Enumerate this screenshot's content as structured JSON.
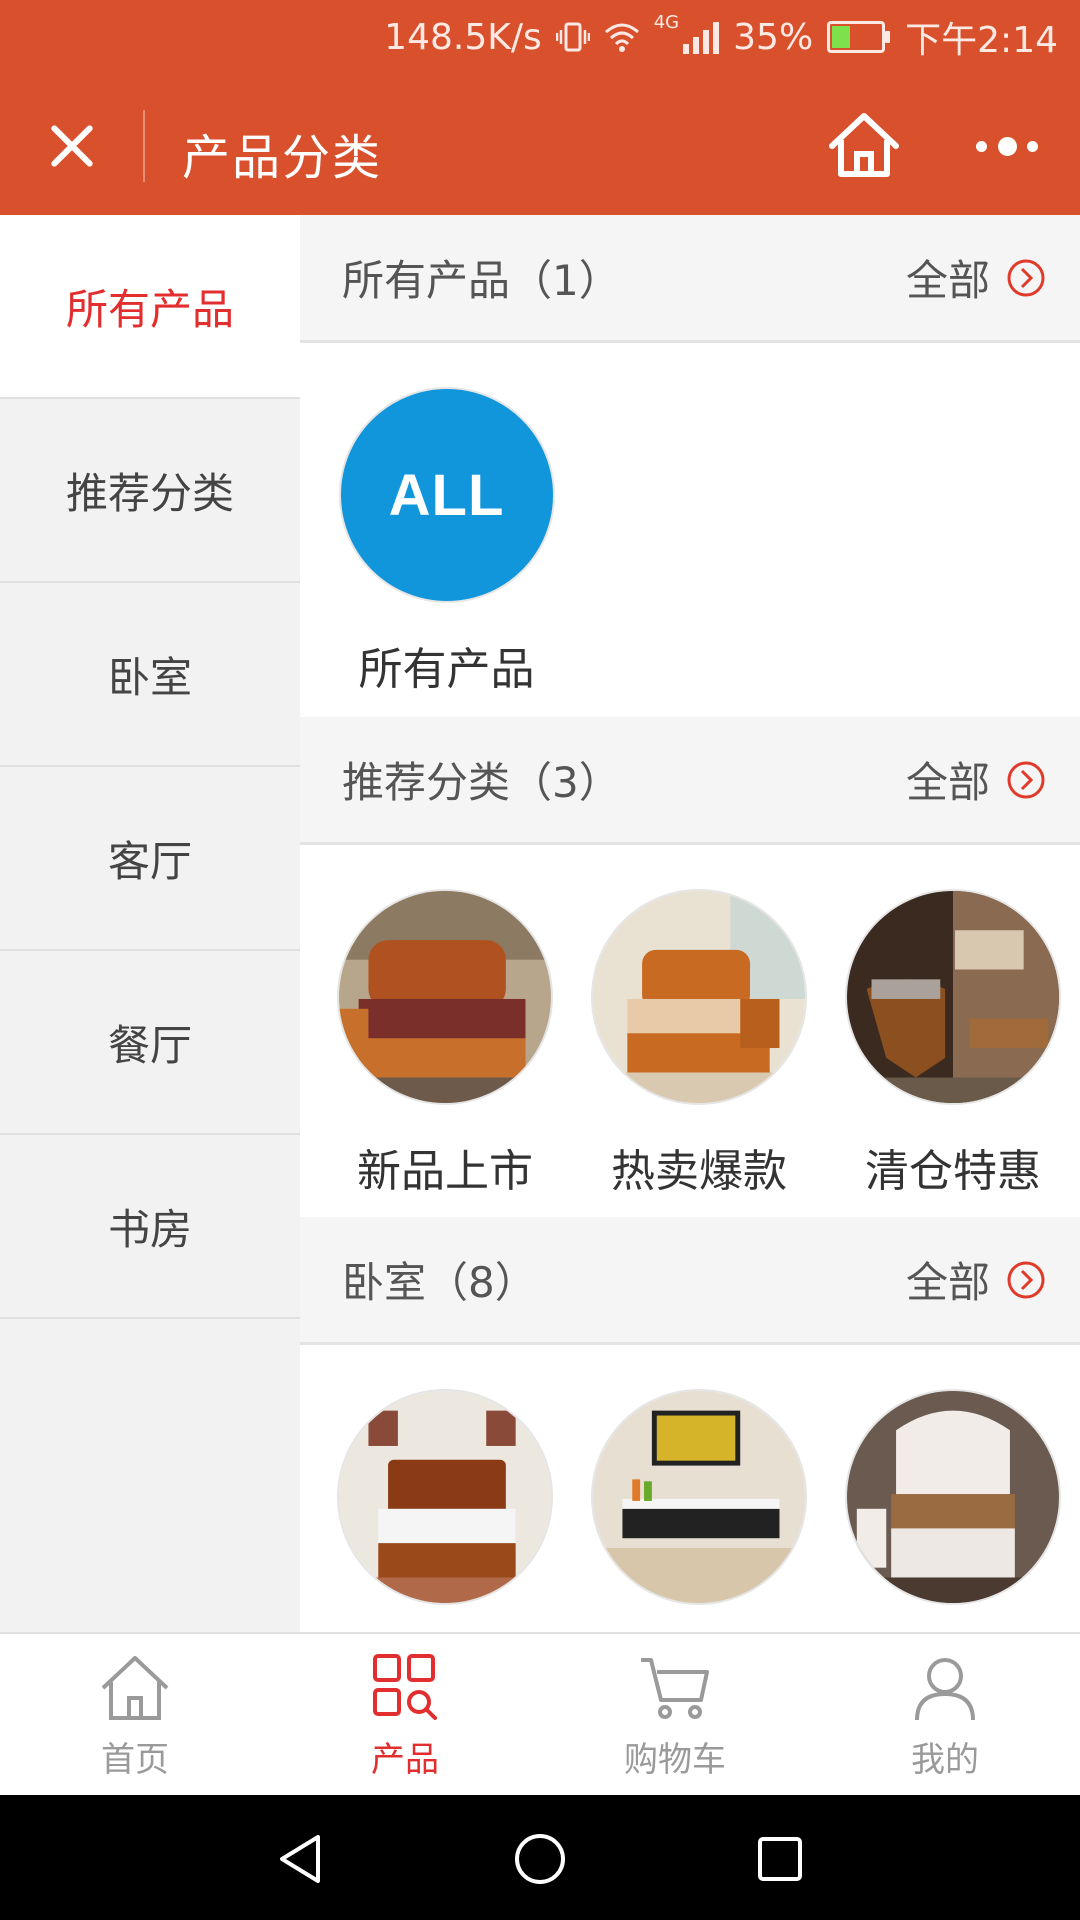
{
  "status_bar": {
    "net_speed": "148.5K/s",
    "network": "4G",
    "battery": "35%",
    "time": "下午2:14"
  },
  "header": {
    "title": "产品分类",
    "icons": [
      "close-icon",
      "home-icon",
      "more-icon"
    ]
  },
  "sidebar": {
    "items": [
      {
        "label": "所有产品",
        "active": true
      },
      {
        "label": "推荐分类",
        "active": false
      },
      {
        "label": "卧室",
        "active": false
      },
      {
        "label": "客厅",
        "active": false
      },
      {
        "label": "餐厅",
        "active": false
      },
      {
        "label": "书房",
        "active": false
      }
    ]
  },
  "sections": [
    {
      "title": "所有产品（1）",
      "see_all": "全部",
      "items": [
        {
          "name": "所有产品",
          "logo_text": "ALL"
        }
      ]
    },
    {
      "title": "推荐分类（3）",
      "see_all": "全部",
      "items": [
        {
          "name": "新品上市"
        },
        {
          "name": "热卖爆款"
        },
        {
          "name": "清仓特惠"
        }
      ]
    },
    {
      "title": "卧室（8）",
      "see_all": "全部"
    }
  ],
  "bottom_nav": [
    {
      "label": "首页",
      "icon": "home-icon",
      "active": false
    },
    {
      "label": "产品",
      "icon": "grid-search-icon",
      "active": true
    },
    {
      "label": "购物车",
      "icon": "cart-icon",
      "active": false
    },
    {
      "label": "我的",
      "icon": "user-icon",
      "active": false
    }
  ],
  "colors": {
    "brand": "#d9502c",
    "active_text": "#e22e2e",
    "all_logo": "#1296db",
    "sidebar_bg": "#f2f2f2"
  }
}
